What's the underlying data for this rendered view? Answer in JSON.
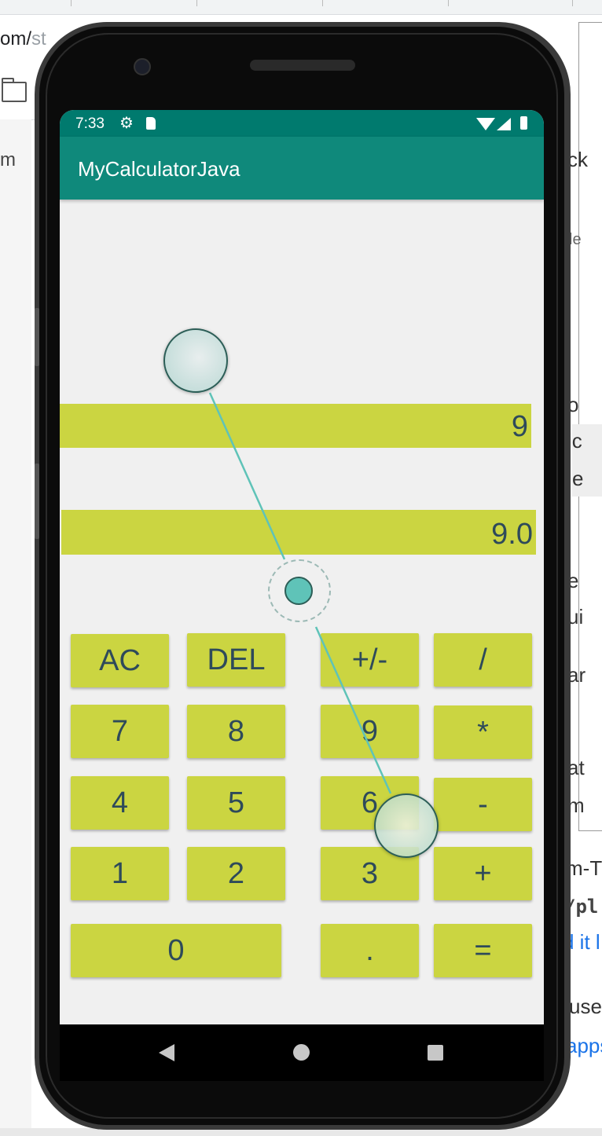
{
  "background_page": {
    "url_fragment": "om/",
    "url_fragment_faded": "st",
    "left_fragment": "m",
    "right_fragments": [
      {
        "text": "ck"
      },
      {
        "text": "le"
      },
      {
        "text": "o"
      },
      {
        "text": "ic"
      },
      {
        "text": "e"
      },
      {
        "text": "e"
      },
      {
        "text": "ui"
      },
      {
        "text": "ar"
      },
      {
        "text": "at"
      },
      {
        "text": "m"
      },
      {
        "text": "m-T"
      },
      {
        "text": "/pl"
      },
      {
        "text": "d it l"
      },
      {
        "text": "use"
      },
      {
        "text": "apps"
      }
    ]
  },
  "status_bar": {
    "time": "7:33",
    "icons": [
      "gear-icon",
      "sd-card-icon",
      "wifi-icon",
      "signal-icon",
      "battery-icon"
    ]
  },
  "app_bar": {
    "title": "MyCalculatorJava"
  },
  "display": {
    "input": "9",
    "result": "9.0"
  },
  "keypad": {
    "rows": [
      [
        "AC",
        "DEL",
        "+/-",
        "/"
      ],
      [
        "7",
        "8",
        "9",
        "*"
      ],
      [
        "4",
        "5",
        "6",
        "-"
      ],
      [
        "1",
        "2",
        "3",
        "+"
      ],
      [
        "0",
        ".",
        "="
      ]
    ]
  },
  "nav_bar": {
    "buttons": [
      "back-icon",
      "home-icon",
      "recents-icon"
    ]
  },
  "colors": {
    "status_bar": "#007a6e",
    "app_bar": "#0f897b",
    "button": "#cbd541",
    "button_text": "#2e4a5a",
    "screen_bg": "#f0f0f0",
    "touch_trail": "#5fc3b8"
  }
}
